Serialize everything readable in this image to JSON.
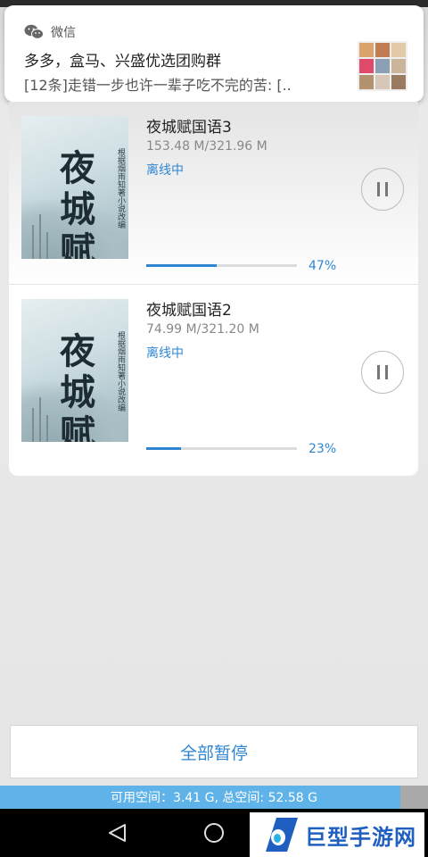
{
  "notification": {
    "app": "微信",
    "title": "多多，盒马、兴盛优选团购群",
    "text": "[12条]走错一步也许一辈子吃不完的苦: [.."
  },
  "downloads": [
    {
      "title": "夜城赋国语3",
      "size": "153.48 M/321.96 M",
      "status": "离线中",
      "progress": 0.47,
      "percent": "47%",
      "cover_title": "夜城赋",
      "cover_subtitle": "根据烟雨知著小说改编"
    },
    {
      "title": "夜城赋国语2",
      "size": "74.99 M/321.20 M",
      "status": "离线中",
      "progress": 0.23,
      "percent": "23%",
      "cover_title": "夜城赋",
      "cover_subtitle": "根据烟雨知著小说改编"
    }
  ],
  "footer": {
    "pause_all_label": "全部暂停",
    "storage_text": "可用空间：3.41 G, 总空间: 52.58 G",
    "storage_used_fraction": 0.935
  },
  "watermark": {
    "text": "巨型手游网"
  },
  "colors": {
    "accent": "#2e86d2",
    "storage_bar": "#5fb3e8"
  }
}
